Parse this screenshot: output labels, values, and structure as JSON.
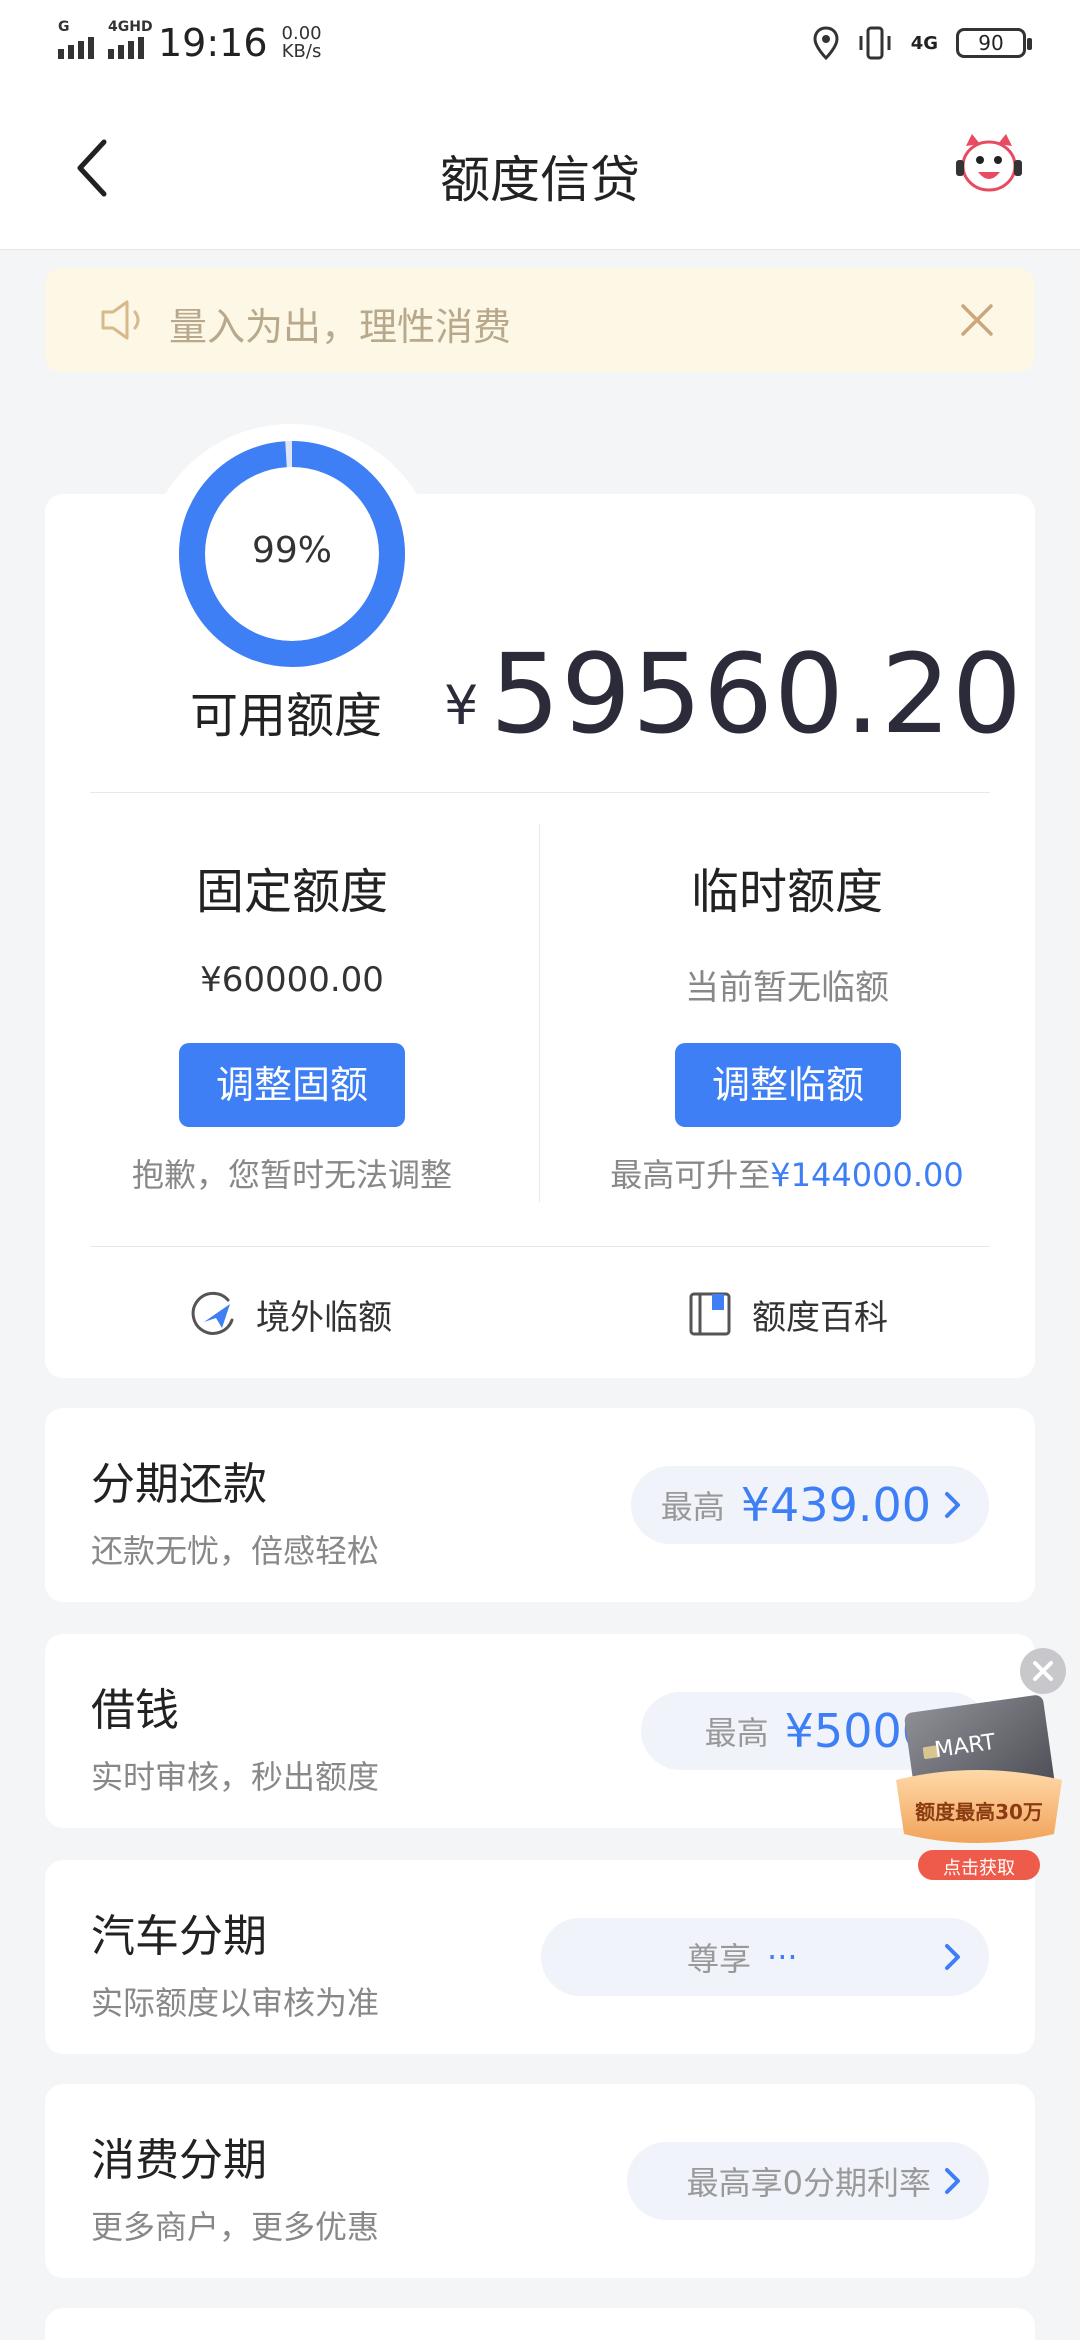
{
  "status_bar": {
    "signal1_label": "G",
    "signal2_label": "4GHD",
    "time": "19:16",
    "speed_value": "0.00",
    "speed_unit": "KB/s",
    "network": "4G",
    "battery": "90"
  },
  "header": {
    "title": "额度信贷"
  },
  "notice": {
    "text": "量入为出，理性消费"
  },
  "credit": {
    "percent": "99%",
    "percent_value": 0.99,
    "available_label": "可用额度",
    "currency_symbol": "¥",
    "available_amount": "59560.20",
    "fixed": {
      "title": "固定额度",
      "amount": "¥60000.00",
      "button": "调整固额",
      "note": "抱歉，您暂时无法调整"
    },
    "temp": {
      "title": "临时额度",
      "status": "当前暂无临额",
      "button": "调整临额",
      "note_prefix": "最高可升至",
      "note_amount": "¥144000.00"
    },
    "links": {
      "overseas": "境外临额",
      "wiki": "额度百科"
    }
  },
  "products": [
    {
      "title": "分期还款",
      "subtitle": "还款无忧，倍感轻松",
      "pill_prefix": "最高",
      "pill_value": "¥439.00"
    },
    {
      "title": "借钱",
      "subtitle": "实时审核，秒出额度",
      "pill_prefix": "最高",
      "pill_value": "¥5000"
    },
    {
      "title": "汽车分期",
      "subtitle": "实际额度以审核为准",
      "pill_prefix": "尊享",
      "pill_value": "···"
    },
    {
      "title": "消费分期",
      "subtitle": "更多商户，更多优惠",
      "pill_prefix": "最高享0分期利率",
      "pill_value": ""
    }
  ],
  "ad": {
    "line1": "额度最高30万",
    "line2": "点击获取",
    "card_text": "MART"
  },
  "colors": {
    "accent": "#3f7ff5",
    "notice_bg": "#fdf7e6",
    "page_bg": "#f4f5f7"
  }
}
